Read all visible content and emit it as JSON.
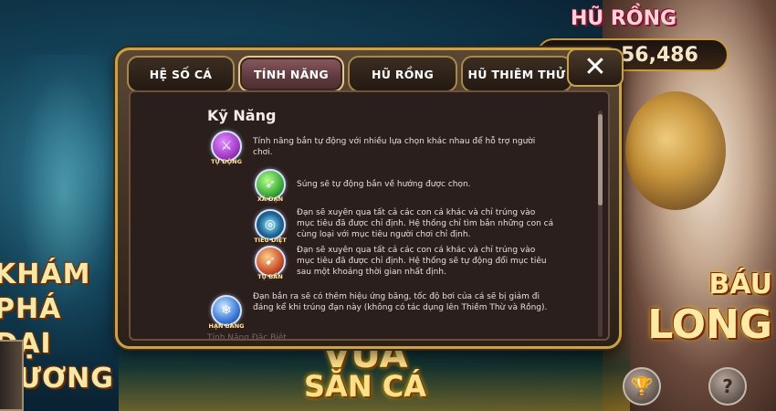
{
  "background": {
    "left_title": "KHÁM PHÁ ĐẠI DƯƠNG",
    "right_title_line1": "BÁU",
    "right_title_line2": "LONG",
    "jackpot_title": "HŨ RỒNG",
    "jackpot_value": "56,486",
    "bottom_title_line1": "VUA",
    "bottom_title_line2": "SĂN CÁ",
    "trophy_button": "🏆",
    "help_button": "?"
  },
  "modal": {
    "tabs": [
      {
        "label": "HỆ SỐ CÁ",
        "active": false
      },
      {
        "label": "TÍNH NĂNG",
        "active": true
      },
      {
        "label": "HŨ RỒNG",
        "active": false
      },
      {
        "label": "HŨ THIÊM THỬ",
        "active": false
      }
    ],
    "close_label": "✕",
    "section_title": "Kỹ Năng",
    "faded_text": "Tính Năng Đặc Biệt",
    "skills": [
      {
        "name": "auto-fire",
        "caption": "TỰ ĐỘNG",
        "icon": "crossed-swords-icon",
        "color": "#a43cc8",
        "text": "Tính năng bắn tự động với nhiều lựa chọn khác nhau để hỗ trợ người chơi."
      },
      {
        "name": "free-fire",
        "caption": "XẢ ĐẠN",
        "icon": "bullet-spray-icon",
        "color": "#3caa3c",
        "text": "Súng sẽ tự động bắn về hướng được chọn."
      },
      {
        "name": "target-kill",
        "caption": "TIÊU DIỆT",
        "icon": "crosshair-icon",
        "color": "#1f6a9a",
        "text": "Đạn sẽ xuyên qua tất cả các con cá khác và chỉ trúng vào mục tiêu đã được chỉ định. Hệ thống chỉ tìm bắn những con cá cùng loại với mục tiêu người chơi chỉ định."
      },
      {
        "name": "self-pick",
        "caption": "TỰ BẮN",
        "icon": "flame-bullet-icon",
        "color": "#c8502a",
        "text": "Đạn sẽ xuyên qua tất cả các con cá khác và chỉ trúng vào mục tiêu đã được chỉ định. Hệ thống sẽ tự động đổi mục tiêu sau một khoảng thời gian nhất định."
      },
      {
        "name": "freeze",
        "caption": "HẠN BĂNG",
        "icon": "ice-shard-icon",
        "color": "#3a7ad8",
        "text": "Đạn bắn ra sẽ có thêm hiệu ứng băng, tốc độ bơi của cá sẽ bị giảm đi đáng kể khi trúng đạn này (không có tác dụng lên Thiềm Thừ và Rồng)."
      }
    ]
  }
}
